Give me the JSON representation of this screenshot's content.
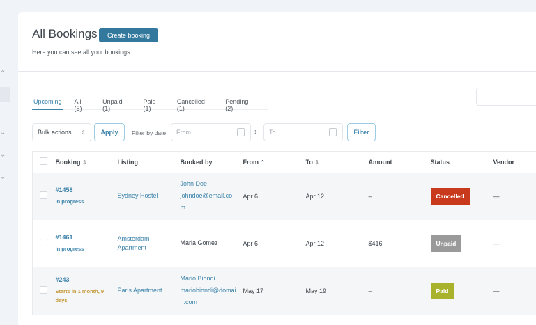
{
  "page": {
    "title": "All Bookings",
    "create_label": "Create booking",
    "subtitle": "Here you can see all your bookings."
  },
  "tabs": [
    {
      "label": "Upcoming",
      "active": true
    },
    {
      "label": "All (5)"
    },
    {
      "label": "Unpaid (1)"
    },
    {
      "label": "Paid (1)"
    },
    {
      "label": "Cancelled (1)"
    },
    {
      "label": "Pending (2)"
    }
  ],
  "toolbar": {
    "bulk_actions": "Bulk actions",
    "apply": "Apply",
    "filter_by_date": "Filter by date",
    "from_placeholder": "From",
    "to_placeholder": "To",
    "filter": "Filter"
  },
  "columns": [
    "Booking",
    "Listing",
    "Booked by",
    "From",
    "To",
    "Amount",
    "Status",
    "Vendor"
  ],
  "rows": [
    {
      "id": "#1458",
      "state": "In progress",
      "state_color": "#3c83ab",
      "listing": "Sydney Hostel",
      "booked_by": "John Doe",
      "email": "johndoe@email.com",
      "from": "Apr 6",
      "to": "Apr 12",
      "amount": "–",
      "status": "Cancelled",
      "status_color": "#c9391c",
      "vendor": "—"
    },
    {
      "id": "#1461",
      "state": "In progress",
      "state_color": "#3c83ab",
      "listing": "Amsterdam Apartment",
      "booked_by": "Maria Gomez",
      "email": "",
      "from": "Apr 6",
      "to": "Apr 12",
      "amount": "$416",
      "status": "Unpaid",
      "status_color": "#9a9a9a",
      "vendor": "—"
    },
    {
      "id": "#243",
      "state": "Starts in 1 month, 9 days",
      "state_color": "#c59a3c",
      "listing": "Paris Apartment",
      "booked_by": "Mario Biondi",
      "email": "mariobiondi@domain.com",
      "from": "May 17",
      "to": "May 19",
      "amount": "–",
      "status": "Paid",
      "status_color": "#a9b22c",
      "vendor": "—"
    }
  ]
}
